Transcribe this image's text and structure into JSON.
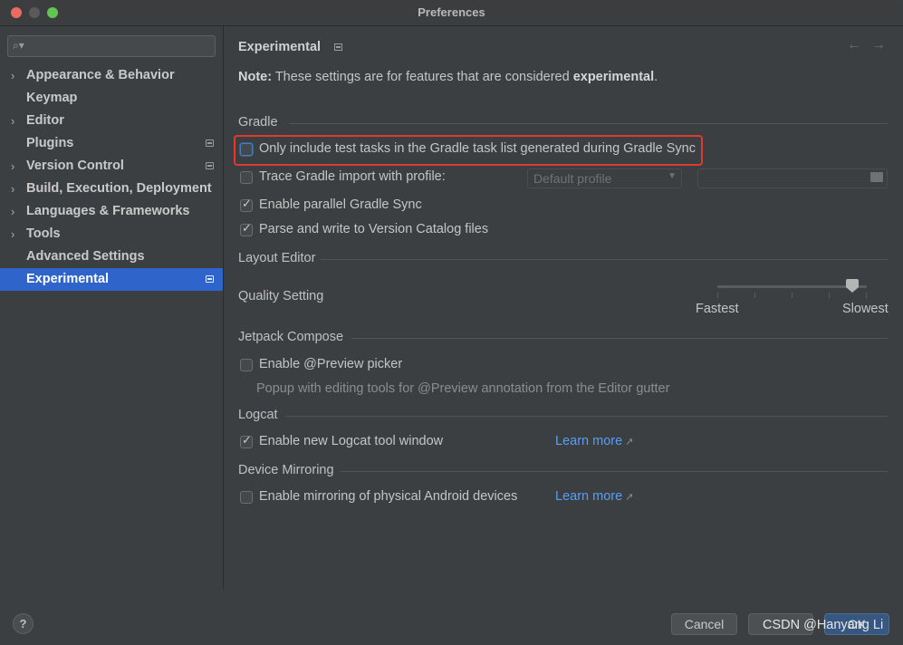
{
  "window": {
    "title": "Preferences"
  },
  "sidebar": {
    "search_placeholder": "",
    "items": [
      {
        "label": "Appearance & Behavior",
        "expandable": true,
        "badge": false,
        "selected": false
      },
      {
        "label": "Keymap",
        "expandable": false,
        "badge": false,
        "selected": false
      },
      {
        "label": "Editor",
        "expandable": true,
        "badge": false,
        "selected": false
      },
      {
        "label": "Plugins",
        "expandable": false,
        "badge": true,
        "selected": false
      },
      {
        "label": "Version Control",
        "expandable": true,
        "badge": true,
        "selected": false
      },
      {
        "label": "Build, Execution, Deployment",
        "expandable": true,
        "badge": false,
        "selected": false
      },
      {
        "label": "Languages & Frameworks",
        "expandable": true,
        "badge": false,
        "selected": false
      },
      {
        "label": "Tools",
        "expandable": true,
        "badge": false,
        "selected": false
      },
      {
        "label": "Advanced Settings",
        "expandable": false,
        "badge": false,
        "selected": false
      },
      {
        "label": "Experimental",
        "expandable": false,
        "badge": true,
        "selected": true
      }
    ]
  },
  "page": {
    "title": "Experimental",
    "note_prefix": "Note:",
    "note_text": " These settings are for features that are considered ",
    "note_emphasis": "experimental",
    "note_suffix": "."
  },
  "gradle": {
    "section": "Gradle",
    "only_include_test_tasks": {
      "label": "Only include test tasks in the Gradle task list generated during Gradle Sync",
      "checked": false
    },
    "trace_import": {
      "label": "Trace Gradle import with profile:",
      "checked": false
    },
    "profile_select": "Default profile",
    "profile_path": "",
    "parallel_sync": {
      "label": "Enable parallel Gradle Sync",
      "checked": true
    },
    "version_catalog": {
      "label": "Parse and write to Version Catalog files",
      "checked": true
    }
  },
  "layout_editor": {
    "section": "Layout Editor",
    "quality_label": "Quality Setting",
    "slider_min_label": "Fastest",
    "slider_max_label": "Slowest",
    "slider_value": 0.9
  },
  "compose": {
    "section": "Jetpack Compose",
    "preview_picker": {
      "label": "Enable @Preview picker",
      "checked": false
    },
    "preview_hint": "Popup with editing tools for @Preview annotation from the Editor gutter"
  },
  "logcat": {
    "section": "Logcat",
    "new_window": {
      "label": "Enable new Logcat tool window",
      "checked": true
    },
    "learn_more": "Learn more"
  },
  "mirroring": {
    "section": "Device Mirroring",
    "physical_devices": {
      "label": "Enable mirroring of physical Android devices",
      "checked": false
    },
    "learn_more": "Learn more"
  },
  "footer": {
    "help": "?",
    "cancel": "Cancel",
    "apply": "",
    "ok": "OK"
  },
  "watermark": "CSDN @Hanyang Li",
  "colors": {
    "accent": "#2f65ca",
    "link": "#589df6",
    "highlight": "#e03a2d"
  }
}
